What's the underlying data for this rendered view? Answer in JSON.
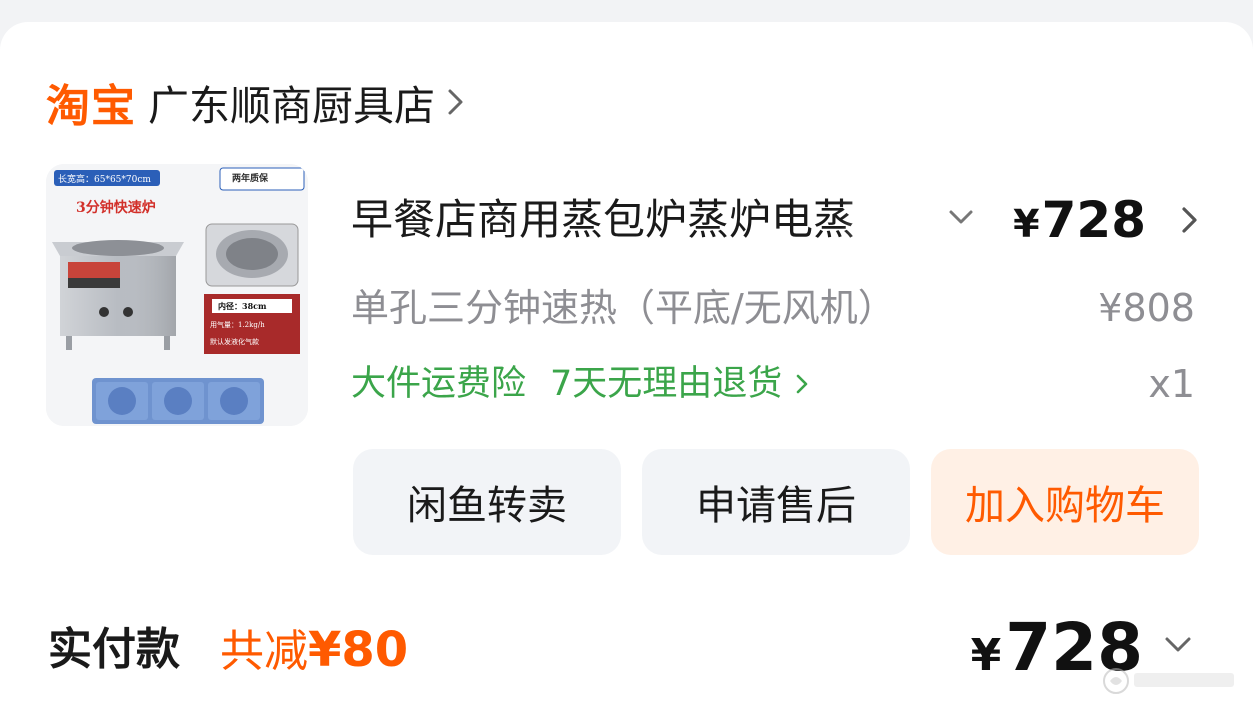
{
  "shop": {
    "brand": "淘宝",
    "name": "广东顺商厨具店"
  },
  "product": {
    "image_badge_left": "长宽高：65*65*70cm",
    "image_badge_right": "两年质保",
    "image_headline": "3分钟快速炉",
    "image_spec_1": "内径：38cm",
    "image_spec_2": "用气量：1.2kg/h",
    "image_spec_3": "默认发液化气款",
    "title": "早餐店商用蒸包炉蒸炉电蒸",
    "price_symbol": "¥",
    "price": "728",
    "spec": "单孔三分钟速热（平底/无风机）",
    "original_price": "¥808",
    "service_1": "大件运费险",
    "service_2": "7天无理由退货",
    "quantity": "x1"
  },
  "actions": {
    "resell": "闲鱼转卖",
    "after_sale": "申请售后",
    "add_cart": "加入购物车"
  },
  "summary": {
    "paid_label": "实付款",
    "discount_prefix": "共减",
    "discount_amount": "¥80",
    "total_symbol": "¥",
    "total": "728"
  },
  "colors": {
    "brand_orange": "#ff5a00",
    "service_green": "#3ba54a",
    "muted_gray": "#8e8e93"
  },
  "icons": {
    "shop_chevron": "chevron-right-icon",
    "title_chevron": "chevron-down-icon",
    "price_chevron": "chevron-right-icon",
    "service_chevron": "chevron-right-icon",
    "total_chevron": "chevron-down-icon"
  }
}
